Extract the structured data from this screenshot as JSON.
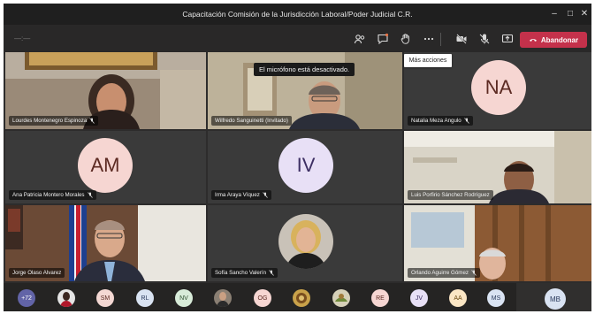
{
  "window": {
    "title": "Capacitación Comisión de la Jurisdicción Laboral/Poder Judicial C.R.",
    "controls": [
      "–",
      "□",
      "✕"
    ]
  },
  "toolbar": {
    "timer": "—:—",
    "more_actions_tooltip": "Más acciones",
    "leave_label": "Abandonar"
  },
  "banner": {
    "mic_disabled": "El micrófono está desactivado."
  },
  "participants": {
    "lourdes": "Lourdes Montenegro Espinoza",
    "wilfredo": "Wilfredo Sanguinetti (Invitado)",
    "natalia": "Natalia Meza Angulo",
    "ana": "Ana Patricia Montero Morales",
    "irma": "Irma Araya Víquez",
    "luis": "Luis Porfirio Sánchez Rodríguez",
    "jorge": "Jorge Olaso Alvarez",
    "sofia": "Sofía Sancho Valerín",
    "orlando": "Orlando Aguirre Gómez"
  },
  "avatars": {
    "natalia_initials": "NA",
    "ana_initials": "AM",
    "irma_initials": "IV"
  },
  "roster": {
    "overflow_count": "+72",
    "initials": [
      "SM",
      "RL",
      "NV",
      "OG",
      "RE",
      "JV",
      "AA",
      "MS"
    ],
    "self_initials": "MB"
  },
  "colors": {
    "leave_button": "#c4314b",
    "avatar_pink": "#f6d6d2",
    "avatar_lavender": "#e8e0f6",
    "overflow_chip": "#6264a7"
  }
}
